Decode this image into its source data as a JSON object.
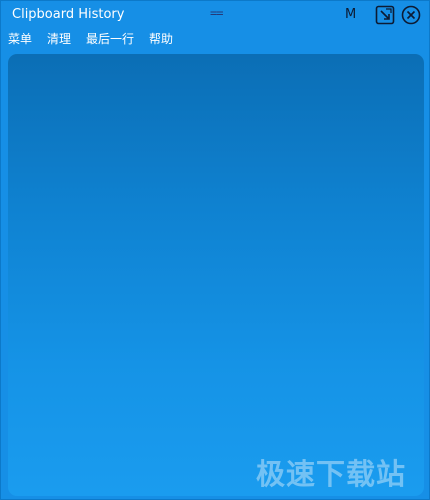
{
  "window": {
    "title": "Clipboard History",
    "grip_label": "==",
    "mode_label": "M",
    "accent_color": "#168fe6",
    "panel_color": "#0f82d1"
  },
  "titlebar_icons": {
    "restore": "window-restore-icon",
    "close": "close-icon"
  },
  "menu": {
    "items": [
      "菜单",
      "清理",
      "最后一行",
      "帮助"
    ]
  },
  "watermark": {
    "text": "极速下载站"
  }
}
